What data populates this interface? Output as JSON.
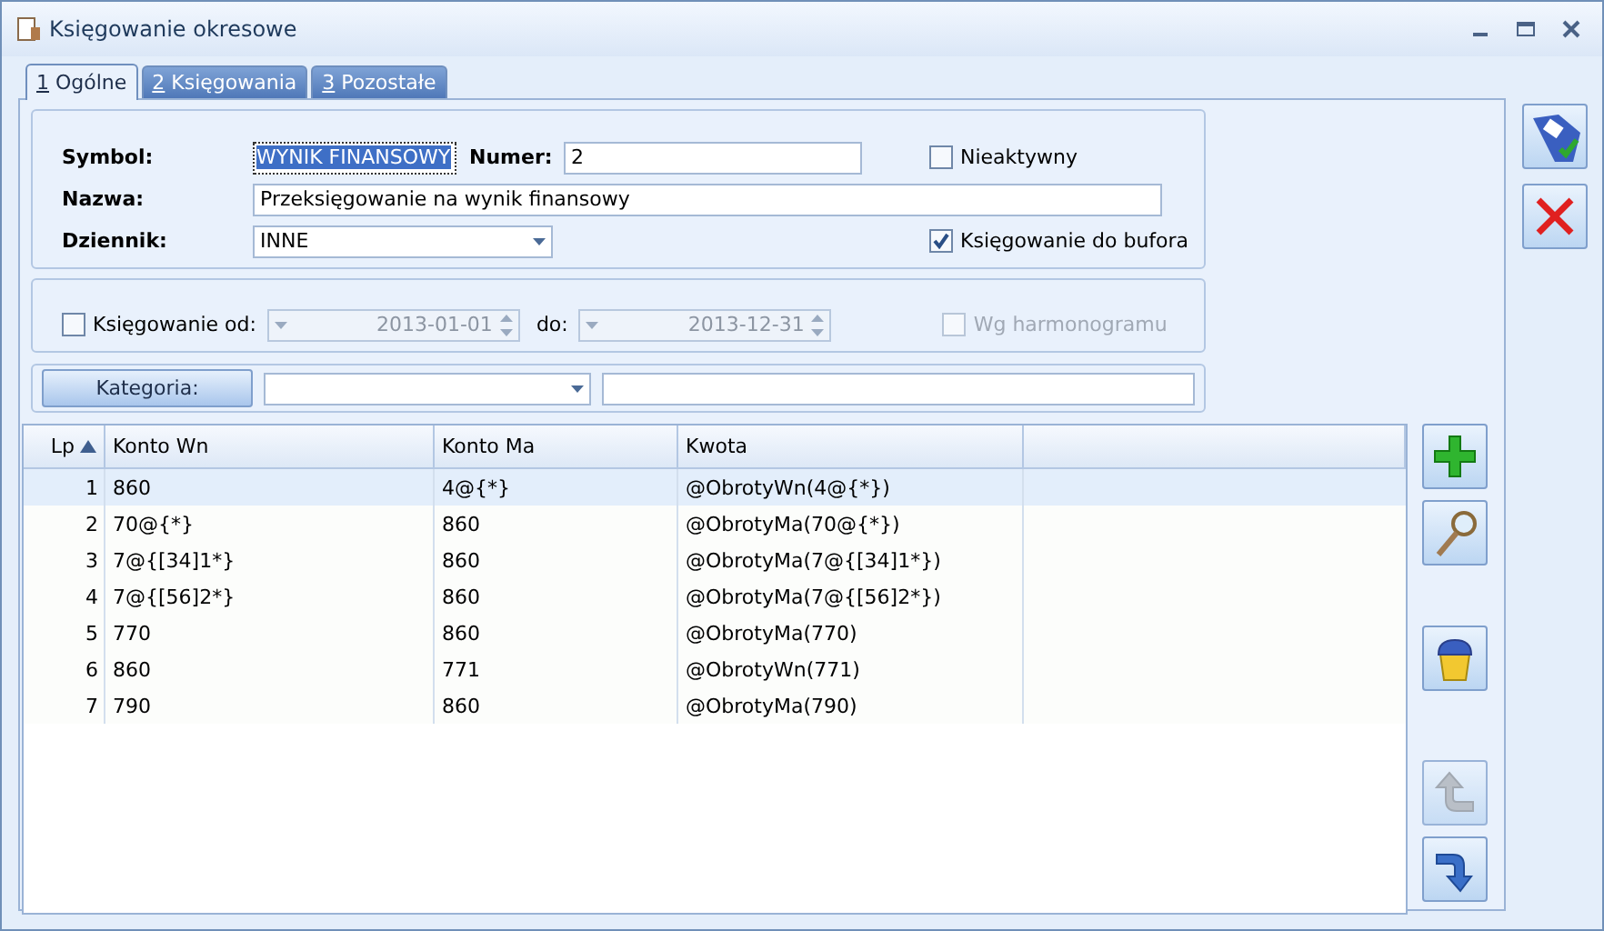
{
  "window": {
    "title": "Księgowanie okresowe"
  },
  "tabs": [
    {
      "key": "1",
      "label": "Ogólne",
      "selected": true
    },
    {
      "key": "2",
      "label": "Księgowania",
      "selected": false
    },
    {
      "key": "3",
      "label": "Pozostałe",
      "selected": false
    }
  ],
  "general": {
    "symbol": {
      "label": "Symbol:",
      "value": "WYNIK FINANSOWY",
      "selected": true
    },
    "numer": {
      "label": "Numer:",
      "value": "2"
    },
    "nieaktywny": {
      "label": "Nieaktywny",
      "checked": false
    },
    "nazwa": {
      "label": "Nazwa:",
      "value": "Przeksięgowanie na wynik finansowy"
    },
    "dziennik": {
      "label": "Dziennik:",
      "value": "INNE"
    },
    "do_bufora": {
      "label": "Księgowanie do bufora",
      "checked": true
    }
  },
  "period": {
    "checkbox": {
      "label": "Księgowanie od:",
      "checked": false
    },
    "from": "2013-01-01",
    "to_label": "do:",
    "to": "2013-12-31",
    "disabled": true,
    "harmonogram": {
      "label": "Wg harmonogramu",
      "checked": false,
      "disabled": true
    }
  },
  "kategoria": {
    "button": "Kategoria:"
  },
  "table": {
    "columns": [
      {
        "label": "Lp",
        "sorted_ascending": true
      },
      {
        "label": "Konto Wn"
      },
      {
        "label": "Konto Ma"
      },
      {
        "label": "Kwota"
      }
    ],
    "rows": [
      {
        "cells": [
          "1",
          "860",
          "4@{*}",
          "@ObrotyWn(4@{*})"
        ],
        "selected": true
      },
      {
        "cells": [
          "2",
          "70@{*}",
          "860",
          "@ObrotyMa(70@{*})"
        ],
        "selected": false
      },
      {
        "cells": [
          "3",
          "7@{[34]1*}",
          "860",
          "@ObrotyMa(7@{[34]1*})"
        ],
        "selected": false
      },
      {
        "cells": [
          "4",
          "7@{[56]2*}",
          "860",
          "@ObrotyMa(7@{[56]2*})"
        ],
        "selected": false
      },
      {
        "cells": [
          "5",
          "770",
          "860",
          "@ObrotyMa(770)"
        ],
        "selected": false
      },
      {
        "cells": [
          "6",
          "860",
          "771",
          "@ObrotyWn(771)"
        ],
        "selected": false
      },
      {
        "cells": [
          "7",
          "790",
          "860",
          "@ObrotyMa(790)"
        ],
        "selected": false
      }
    ]
  },
  "grid_buttons": [
    {
      "kind": "add",
      "disabled": false
    },
    {
      "kind": "view",
      "disabled": false
    },
    {
      "kind": "delete",
      "disabled": false
    },
    {
      "kind": "undo",
      "disabled": true
    },
    {
      "kind": "redo",
      "disabled": false
    }
  ],
  "actions": [
    {
      "kind": "save"
    },
    {
      "kind": "cancel"
    }
  ]
}
